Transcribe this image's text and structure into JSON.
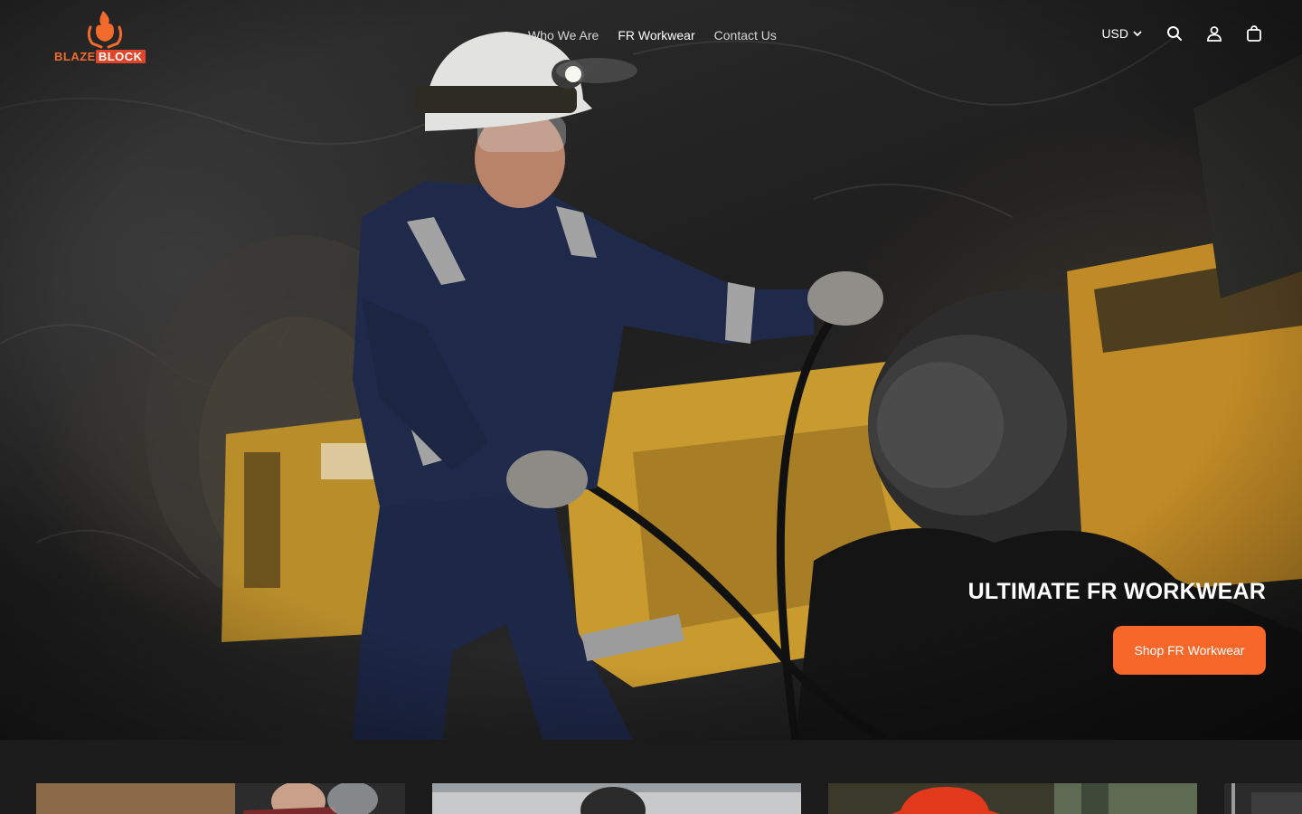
{
  "brand": {
    "name_part1": "BLAZE",
    "name_part2": "BLOCK",
    "accent": "#f7672a"
  },
  "nav": {
    "items": [
      {
        "label": "Who We Are",
        "active": false
      },
      {
        "label": "FR Workwear",
        "active": true
      },
      {
        "label": "Contact Us",
        "active": false
      }
    ]
  },
  "header": {
    "currency": "USD",
    "icons": [
      "search-icon",
      "account-icon",
      "cart-icon"
    ]
  },
  "hero": {
    "title": "ULTIMATE FR WORKWEAR",
    "cta_label": "Shop FR Workwear"
  },
  "colors": {
    "background": "#1b1b1b",
    "cta": "#f7672a",
    "coverall": "#1f2a4a",
    "machine_yellow": "#c99a2e"
  }
}
